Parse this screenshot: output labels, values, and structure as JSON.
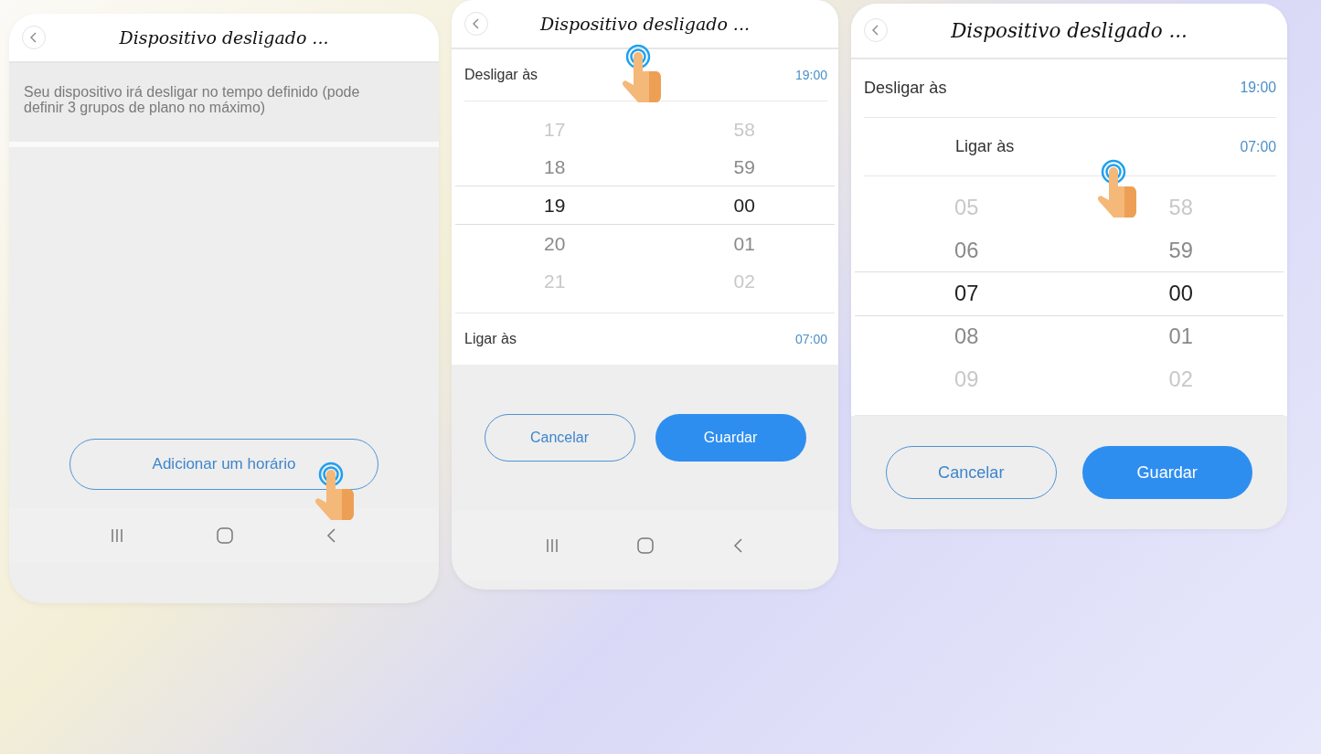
{
  "screens": [
    {
      "kind": "intro",
      "title": "Dispositivo desligado ...",
      "description": "Seu dispositivo irá desligar no tempo definido (pode definir 3 grupos de plano no máximo)",
      "add_button": "Adicionar um horário",
      "nav_bar": true
    },
    {
      "kind": "picker",
      "title": "Dispositivo desligado ...",
      "nav_bar": true,
      "rows": [
        {
          "label": "Desligar às",
          "value": "19:00",
          "expanded": true,
          "wheel": [
            {
              "hour": "17",
              "minute": "58",
              "selected": false
            },
            {
              "hour": "18",
              "minute": "59",
              "selected": false
            },
            {
              "hour": "19",
              "minute": "00",
              "selected": true
            },
            {
              "hour": "20",
              "minute": "01",
              "selected": false
            },
            {
              "hour": "21",
              "minute": "02",
              "selected": false
            }
          ]
        },
        {
          "label": "Ligar às",
          "value": "07:00",
          "expanded": false
        }
      ],
      "buttons": {
        "cancel": "Cancelar",
        "save": "Guardar"
      }
    },
    {
      "kind": "picker",
      "title": "Dispositivo desligado ...",
      "nav_bar": false,
      "rows": [
        {
          "label": "Desligar às",
          "value": "19:00",
          "expanded": false
        },
        {
          "label": "Ligar às",
          "value": "07:00",
          "expanded": true,
          "wheel": [
            {
              "hour": "05",
              "minute": "58",
              "selected": false
            },
            {
              "hour": "06",
              "minute": "59",
              "selected": false
            },
            {
              "hour": "07",
              "minute": "00",
              "selected": true
            },
            {
              "hour": "08",
              "minute": "01",
              "selected": false
            },
            {
              "hour": "09",
              "minute": "02",
              "selected": false
            }
          ]
        }
      ],
      "buttons": {
        "cancel": "Cancelar",
        "save": "Guardar"
      }
    }
  ]
}
